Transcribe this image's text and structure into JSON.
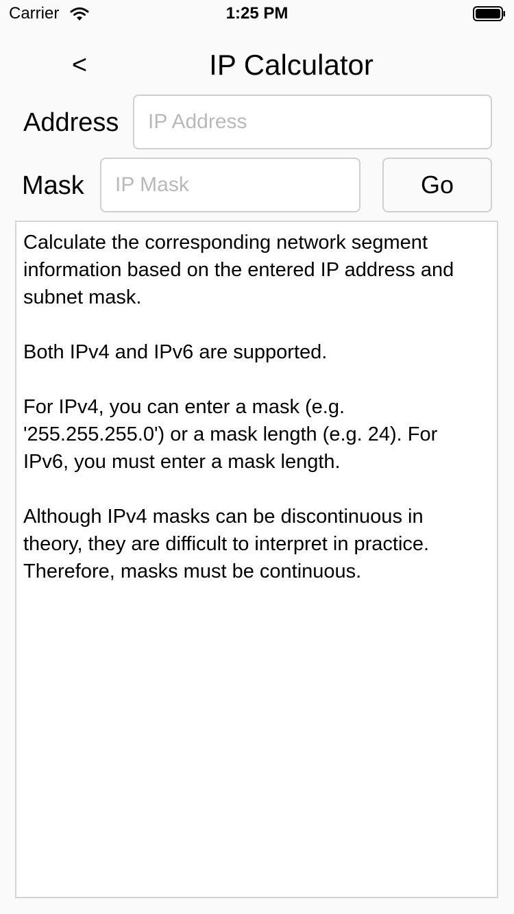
{
  "status_bar": {
    "carrier": "Carrier",
    "time": "1:25 PM",
    "wifi_icon": "wifi-icon",
    "battery_icon": "battery-full-icon"
  },
  "nav": {
    "back_label": "<",
    "title": "IP Calculator"
  },
  "form": {
    "address_label": "Address",
    "address_placeholder": "IP Address",
    "address_value": "",
    "mask_label": "Mask",
    "mask_placeholder": "IP Mask",
    "mask_value": "",
    "go_label": "Go"
  },
  "info": {
    "paragraphs": [
      "Calculate the corresponding network segment\ninformation based on the entered IP address and\nsubnet mask.",
      "Both IPv4 and IPv6 are supported.",
      "For IPv4, you can enter a mask (e.g.\n'255.255.255.0') or a mask length (e.g. 24). For\nIPv6, you must enter a mask length.",
      "Although IPv4 masks can be discontinuous in\ntheory, they are difficult to interpret in practice.\nTherefore, masks must be continuous."
    ]
  },
  "colors": {
    "background": "#fafafa",
    "field_border": "#cfcfcf",
    "placeholder": "#b8b8bd"
  }
}
